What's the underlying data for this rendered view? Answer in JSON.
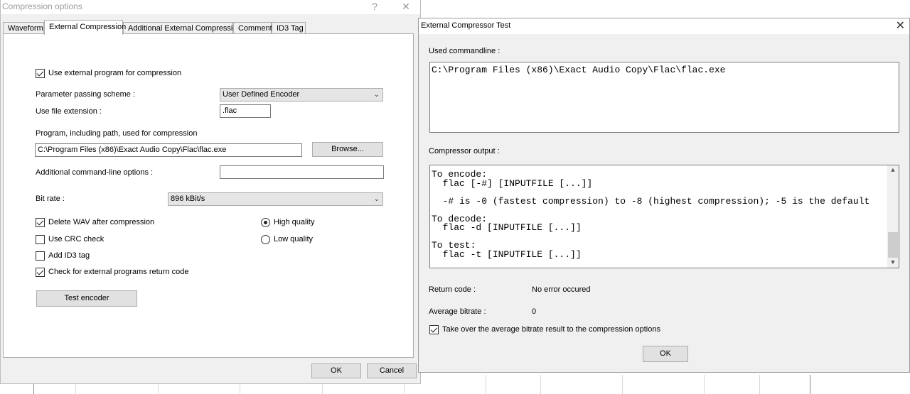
{
  "left_dialog": {
    "title": "Compression options",
    "help_glyph": "?",
    "close_glyph": "✕",
    "tabs": [
      "Waveform",
      "External Compression",
      "Additional External Compression",
      "Comment",
      "ID3 Tag"
    ],
    "active_tab": "External Compression",
    "use_external_label": "Use external program for compression",
    "use_external_checked": true,
    "param_scheme_label": "Parameter passing scheme :",
    "param_scheme_value": "User Defined Encoder",
    "file_ext_label": "Use file extension :",
    "file_ext_value": ".flac",
    "program_label": "Program, including path, used for compression",
    "program_value": "C:\\Program Files (x86)\\Exact Audio Copy\\Flac\\flac.exe",
    "browse_label": "Browse...",
    "add_options_label": "Additional command-line options :",
    "add_options_value": "",
    "bitrate_label": "Bit rate :",
    "bitrate_value": "896 kBit/s",
    "delete_wav_label": "Delete WAV after compression",
    "use_crc_label": "Use CRC check",
    "add_id3_label": "Add ID3 tag",
    "check_return_label": "Check for external programs return code",
    "high_quality_label": "High quality",
    "low_quality_label": "Low quality",
    "test_encoder_label": "Test encoder",
    "ok_label": "OK",
    "cancel_label": "Cancel"
  },
  "right_dialog": {
    "title": "External Compressor Test",
    "used_cmd_label": "Used commandline :",
    "used_cmd_value": "C:\\Program Files (x86)\\Exact Audio Copy\\Flac\\flac.exe",
    "output_label": "Compressor output :",
    "output_text": "To encode:\n  flac [-#] [INPUTFILE [...]]\n\n  -# is -0 (fastest compression) to -8 (highest compression); -5 is the default\n\nTo decode:\n  flac -d [INPUTFILE [...]]\n\nTo test:\n  flac -t [INPUTFILE [...]]\n",
    "return_code_label": "Return code :",
    "return_code_value": "No error occured",
    "avg_bitrate_label": "Average bitrate :",
    "avg_bitrate_value": "0",
    "take_over_label": "Take over the average bitrate result to the compression options",
    "ok_label": "OK"
  }
}
